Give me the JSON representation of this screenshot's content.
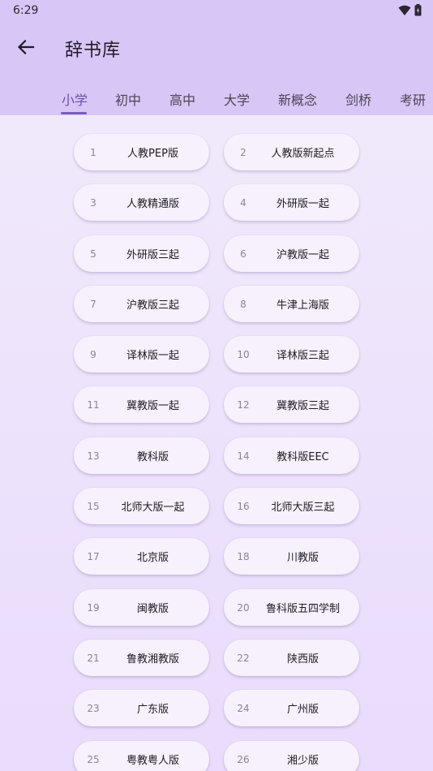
{
  "status_bar": {
    "time": "6:29",
    "wifi_icon": "wifi-icon",
    "battery_icon": "battery-icon"
  },
  "header": {
    "back_icon": "arrow-left-icon",
    "title": "辞书库"
  },
  "tabs": [
    {
      "label": "小学",
      "active": true
    },
    {
      "label": "初中",
      "active": false
    },
    {
      "label": "高中",
      "active": false
    },
    {
      "label": "大学",
      "active": false
    },
    {
      "label": "新概念",
      "active": false
    },
    {
      "label": "剑桥",
      "active": false
    },
    {
      "label": "考研",
      "active": false
    }
  ],
  "items": [
    {
      "num": "1",
      "label": "人教PEP版"
    },
    {
      "num": "2",
      "label": "人教版新起点"
    },
    {
      "num": "3",
      "label": "人教精通版"
    },
    {
      "num": "4",
      "label": "外研版一起"
    },
    {
      "num": "5",
      "label": "外研版三起"
    },
    {
      "num": "6",
      "label": "沪教版一起"
    },
    {
      "num": "7",
      "label": "沪教版三起"
    },
    {
      "num": "8",
      "label": "牛津上海版"
    },
    {
      "num": "9",
      "label": "译林版一起"
    },
    {
      "num": "10",
      "label": "译林版三起"
    },
    {
      "num": "11",
      "label": "冀教版一起"
    },
    {
      "num": "12",
      "label": "冀教版三起"
    },
    {
      "num": "13",
      "label": "教科版"
    },
    {
      "num": "14",
      "label": "教科版EEC"
    },
    {
      "num": "15",
      "label": "北师大版一起"
    },
    {
      "num": "16",
      "label": "北师大版三起"
    },
    {
      "num": "17",
      "label": "北京版"
    },
    {
      "num": "18",
      "label": "川教版"
    },
    {
      "num": "19",
      "label": "闽教版"
    },
    {
      "num": "20",
      "label": "鲁科版五四学制"
    },
    {
      "num": "21",
      "label": "鲁教湘教版"
    },
    {
      "num": "22",
      "label": "陕西版"
    },
    {
      "num": "23",
      "label": "广东版"
    },
    {
      "num": "24",
      "label": "广州版"
    },
    {
      "num": "25",
      "label": "粤教粤人版"
    },
    {
      "num": "26",
      "label": "湘少版"
    }
  ],
  "colors": {
    "appbar": "#d8c6f6",
    "accent": "#7a5cc4",
    "item_bg": "#f6f1fc"
  }
}
